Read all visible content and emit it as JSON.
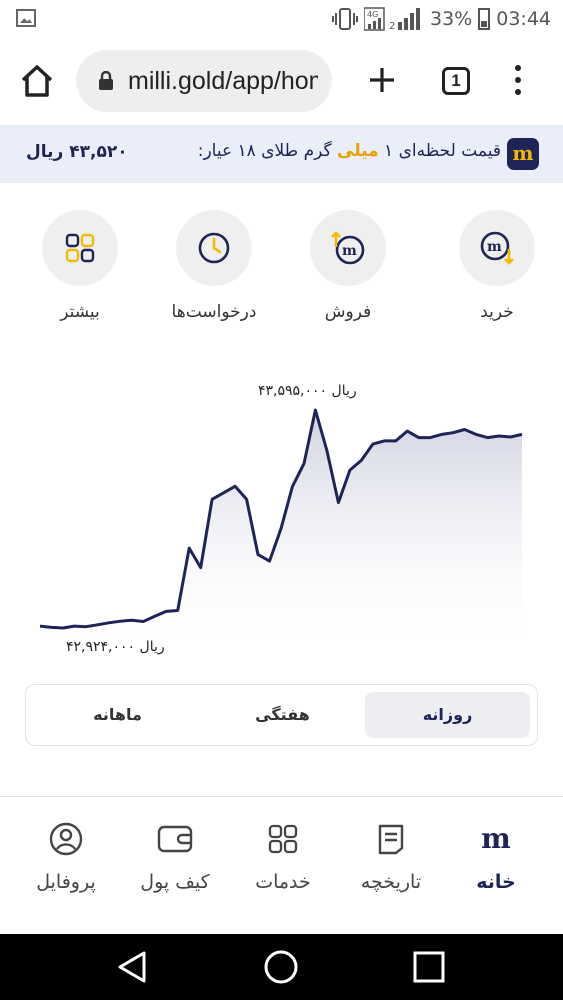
{
  "status_bar": {
    "network": "4G",
    "battery": "33%",
    "time": "03:44",
    "icons": [
      "gallery-icon",
      "vibrate-icon",
      "signal-icon",
      "battery-icon"
    ]
  },
  "browser": {
    "url": "milli.gold/app/home",
    "tab_count": "1",
    "icons": [
      "home-icon",
      "lock-icon",
      "plus-icon",
      "tabs-icon",
      "menu-icon"
    ]
  },
  "price_banner": {
    "label_prefix": "قیمت لحظه‌ای ۱",
    "label_highlight": "میلی",
    "label_suffix": "گرم طلای ۱۸ عیار:",
    "value": "۴۳,۵۲۰ ریال",
    "logo": "m",
    "colors": {
      "navy": "#1f2456",
      "gold": "#e8a200"
    }
  },
  "actions": [
    {
      "label": "خرید",
      "icon": "buy-coin-icon"
    },
    {
      "label": "فروش",
      "icon": "sell-coin-icon"
    },
    {
      "label": "درخواست‌ها",
      "icon": "clock-icon"
    },
    {
      "label": "بیشتر",
      "icon": "grid-icon"
    }
  ],
  "chart_data": {
    "type": "area",
    "max_label": "۴۳,۵۹۵,۰۰۰ ریال",
    "min_label": "۴۲,۹۲۴,۰۰۰ ریال",
    "ylim": [
      42924000,
      43595000
    ],
    "line_color": "#1f2456",
    "fill_color": "#c9cbdc",
    "values": [
      42930000,
      42926000,
      42924000,
      42930000,
      42928000,
      42934000,
      42940000,
      42945000,
      42948000,
      42944000,
      42960000,
      42975000,
      42978000,
      43170000,
      43110000,
      43320000,
      43340000,
      43360000,
      43320000,
      43150000,
      43130000,
      43230000,
      43360000,
      43430000,
      43595000,
      43470000,
      43310000,
      43410000,
      43440000,
      43490000,
      43500000,
      43500000,
      43530000,
      43510000,
      43510000,
      43520000,
      43525000,
      43535000,
      43520000,
      43510000,
      43515000,
      43512000,
      43520000
    ]
  },
  "period_tabs": {
    "daily": "روزانه",
    "weekly": "هفتگی",
    "monthly": "ماهانه",
    "active": "daily"
  },
  "bottom_nav": [
    {
      "label": "خانه",
      "icon": "milli-logo-icon",
      "active": true
    },
    {
      "label": "تاریخچه",
      "icon": "history-icon",
      "active": false
    },
    {
      "label": "خدمات",
      "icon": "services-grid-icon",
      "active": false
    },
    {
      "label": "کیف پول",
      "icon": "wallet-icon",
      "active": false
    },
    {
      "label": "پروفایل",
      "icon": "profile-icon",
      "active": false
    }
  ],
  "android_nav": {
    "icons": [
      "back-icon",
      "home-circle-icon",
      "recents-icon"
    ]
  }
}
